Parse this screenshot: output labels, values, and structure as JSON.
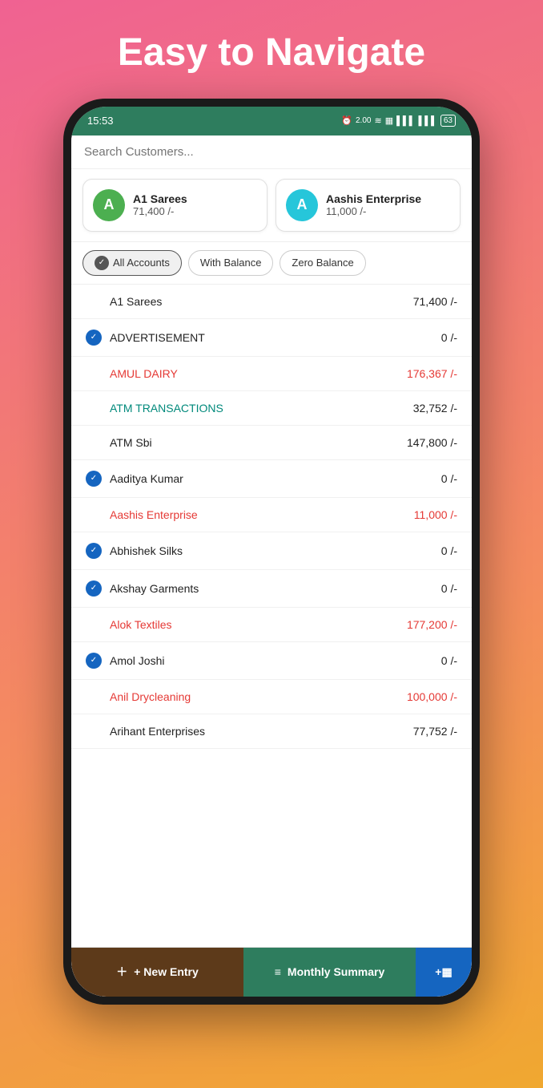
{
  "hero": {
    "title": "Easy to Navigate"
  },
  "statusBar": {
    "time": "15:53",
    "icons": "⏰ 2.00 ≋ ▦ ▌▌▌ 🔋"
  },
  "search": {
    "placeholder": "Search Customers..."
  },
  "pinnedCards": [
    {
      "id": "a1sarees",
      "letter": "A",
      "name": "A1 Sarees",
      "amount": "71,400 /-",
      "avatarClass": "avatar-green"
    },
    {
      "id": "aashis",
      "letter": "A",
      "name": "Aashis Enterprise",
      "amount": "11,000 /-",
      "avatarClass": "avatar-teal"
    }
  ],
  "filters": [
    {
      "id": "all",
      "label": "All Accounts",
      "active": true
    },
    {
      "id": "withbalance",
      "label": "With Balance",
      "active": false
    },
    {
      "id": "zerobalance",
      "label": "Zero Balance",
      "active": false
    }
  ],
  "accounts": [
    {
      "name": "A1 Sarees",
      "amount": "71,400 /-",
      "hasCheck": false,
      "nameClass": "",
      "amountClass": ""
    },
    {
      "name": "ADVERTISEMENT",
      "amount": "0 /-",
      "hasCheck": true,
      "nameClass": "",
      "amountClass": ""
    },
    {
      "name": "AMUL DAIRY",
      "amount": "176,367 /-",
      "hasCheck": false,
      "nameClass": "red",
      "amountClass": "red"
    },
    {
      "name": "ATM  TRANSACTIONS",
      "amount": "32,752 /-",
      "hasCheck": false,
      "nameClass": "teal",
      "amountClass": ""
    },
    {
      "name": "ATM Sbi",
      "amount": "147,800 /-",
      "hasCheck": false,
      "nameClass": "",
      "amountClass": ""
    },
    {
      "name": "Aaditya Kumar",
      "amount": "0 /-",
      "hasCheck": true,
      "nameClass": "",
      "amountClass": ""
    },
    {
      "name": "Aashis Enterprise",
      "amount": "11,000 /-",
      "hasCheck": false,
      "nameClass": "red",
      "amountClass": "red"
    },
    {
      "name": "Abhishek Silks",
      "amount": "0 /-",
      "hasCheck": true,
      "nameClass": "",
      "amountClass": ""
    },
    {
      "name": "Akshay Garments",
      "amount": "0 /-",
      "hasCheck": true,
      "nameClass": "",
      "amountClass": ""
    },
    {
      "name": "Alok Textiles",
      "amount": "177,200 /-",
      "hasCheck": false,
      "nameClass": "red",
      "amountClass": "red"
    },
    {
      "name": "Amol Joshi",
      "amount": "0 /-",
      "hasCheck": true,
      "nameClass": "",
      "amountClass": ""
    },
    {
      "name": "Anil Drycleaning",
      "amount": "100,000 /-",
      "hasCheck": false,
      "nameClass": "red",
      "amountClass": "red"
    },
    {
      "name": "Arihant Enterprises",
      "amount": "77,752 /-",
      "hasCheck": false,
      "nameClass": "",
      "amountClass": ""
    }
  ],
  "bottomNav": {
    "newEntry": "+ New Entry",
    "monthlySummary": "≡ Monthly Summary",
    "extra": "+▦"
  }
}
